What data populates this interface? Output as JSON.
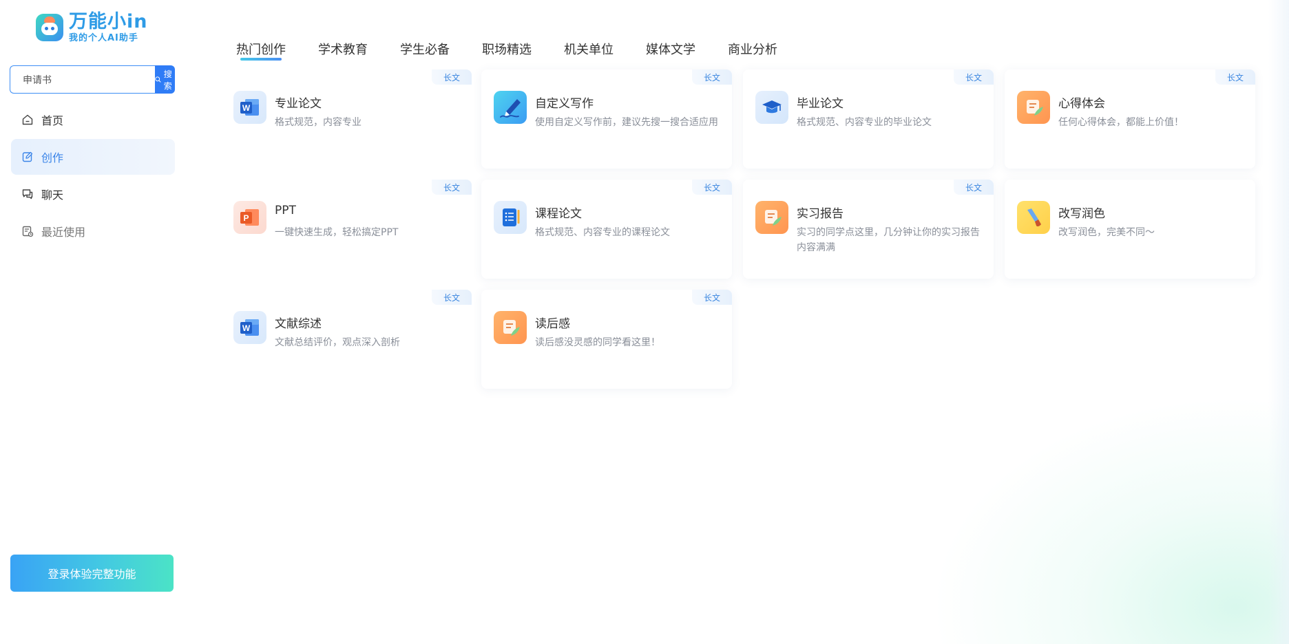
{
  "brand": {
    "title": "万能小in",
    "subtitle": "我的个人AI助手"
  },
  "search": {
    "value": "申请书",
    "button_label": "搜索"
  },
  "nav": {
    "items": [
      {
        "label": "首页",
        "icon": "home-icon"
      },
      {
        "label": "创作",
        "icon": "edit-icon"
      },
      {
        "label": "聊天",
        "icon": "chat-icon"
      },
      {
        "label": "最近使用",
        "icon": "history-icon"
      }
    ],
    "active_index": 1
  },
  "login_button": "登录体验完整功能",
  "tabs": [
    {
      "label": "热门创作"
    },
    {
      "label": "学术教育"
    },
    {
      "label": "学生必备"
    },
    {
      "label": "职场精选"
    },
    {
      "label": "机关单位"
    },
    {
      "label": "媒体文学"
    },
    {
      "label": "商业分析"
    }
  ],
  "active_tab_index": 0,
  "cards": [
    {
      "title": "专业论文",
      "desc": "格式规范，内容专业",
      "badge": "长文",
      "icon": "word-document-icon"
    },
    {
      "title": "自定义写作",
      "desc": "使用自定义写作前，建议先搜一搜合适应用",
      "badge": "长文",
      "icon": "pen-writing-icon"
    },
    {
      "title": "毕业论文",
      "desc": "格式规范、内容专业的毕业论文",
      "badge": "长文",
      "icon": "graduation-cap-icon"
    },
    {
      "title": "心得体会",
      "desc": "任何心得体会，都能上价值！",
      "badge": "长文",
      "icon": "notes-feather-icon"
    },
    {
      "title": "PPT",
      "desc": "一键快速生成，轻松搞定PPT",
      "badge": "长文",
      "icon": "powerpoint-icon"
    },
    {
      "title": "课程论文",
      "desc": "格式规范、内容专业的课程论文",
      "badge": "长文",
      "icon": "notebook-list-icon"
    },
    {
      "title": "实习报告",
      "desc": "实习的同学点这里，几分钟让你的实习报告内容满满",
      "badge": "长文",
      "icon": "report-feather-icon"
    },
    {
      "title": "改写润色",
      "desc": "改写润色，完美不同～",
      "badge": "",
      "icon": "brush-icon"
    },
    {
      "title": "文献综述",
      "desc": "文献总结评价，观点深入剖析",
      "badge": "长文",
      "icon": "word-document-icon"
    },
    {
      "title": "读后感",
      "desc": "读后感没灵感的同学看这里！",
      "badge": "长文",
      "icon": "reading-notes-icon"
    }
  ],
  "colors": {
    "accent": "#2f7cf6",
    "active_nav_text": "#3a84e8",
    "badge_text": "#3a86e0"
  }
}
